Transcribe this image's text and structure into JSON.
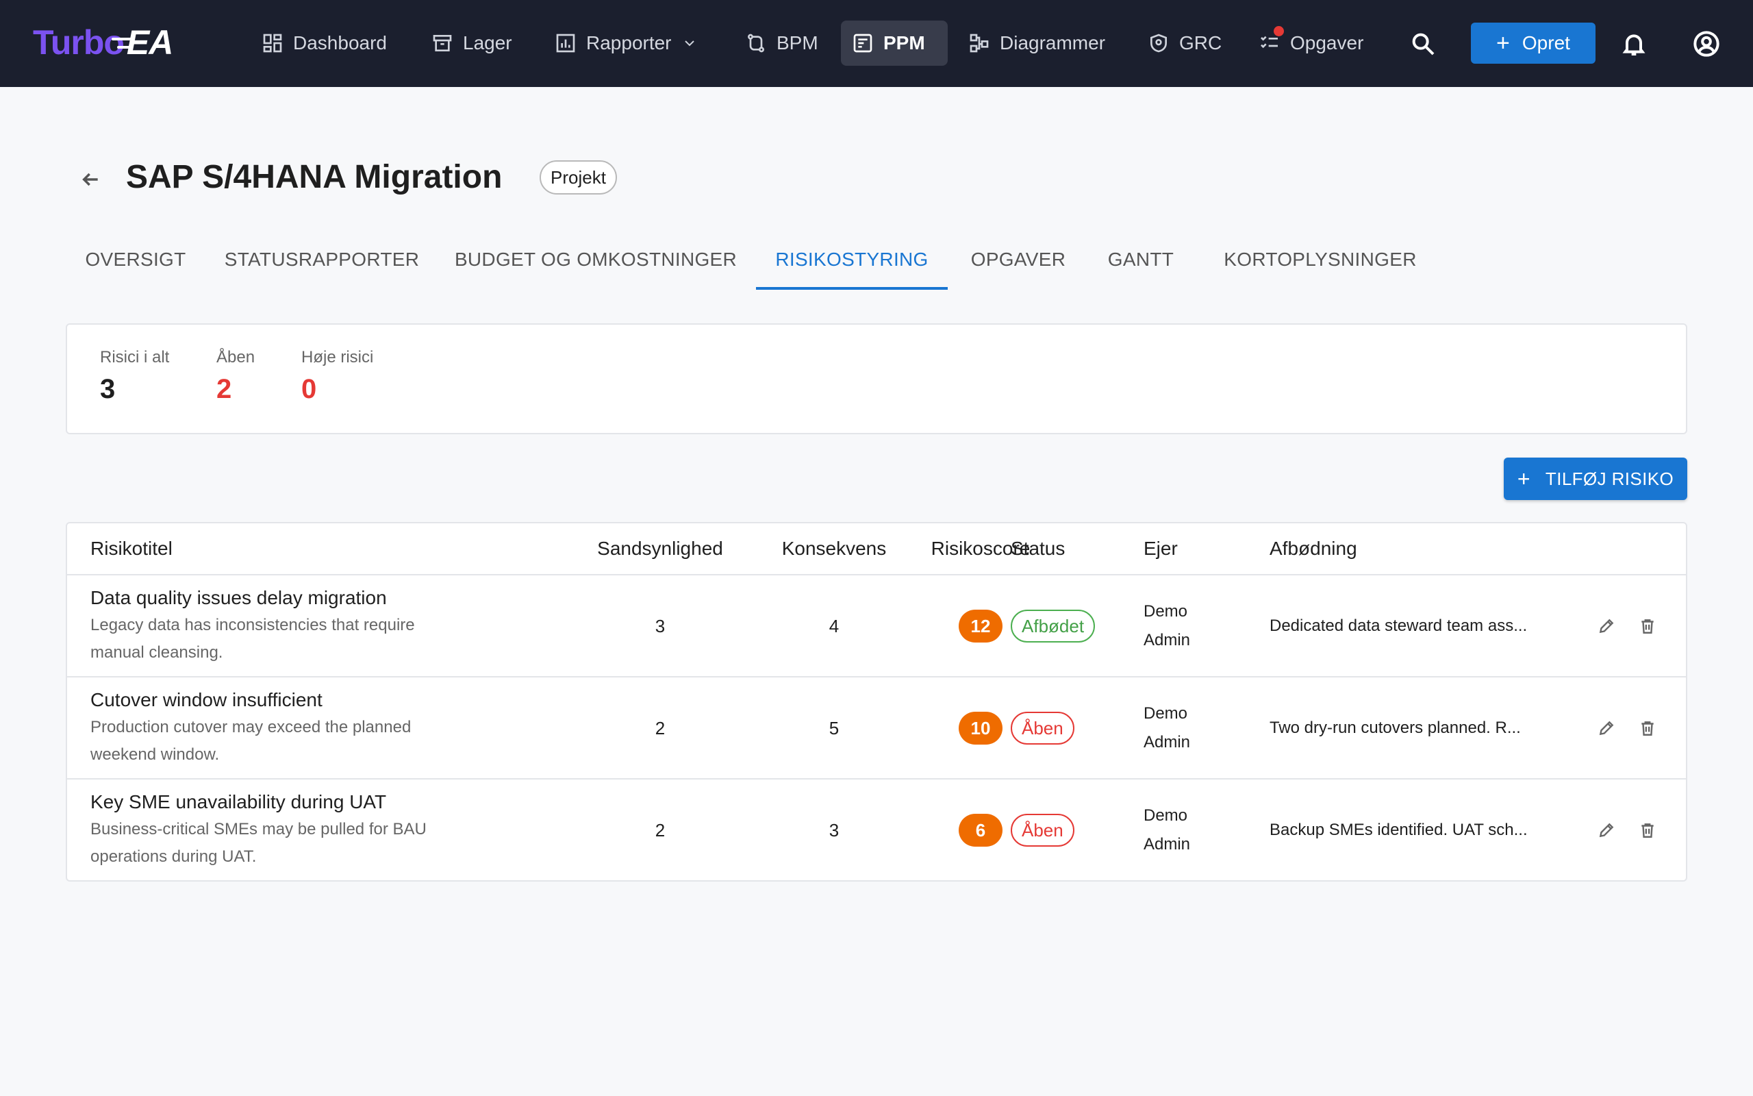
{
  "app": {
    "logo_part1": "Turbo",
    "logo_part2": "EA"
  },
  "nav": {
    "items": [
      {
        "label": "Dashboard",
        "icon": "dashboard-icon"
      },
      {
        "label": "Lager",
        "icon": "archive-icon"
      },
      {
        "label": "Rapporter",
        "icon": "bar-chart-icon"
      },
      {
        "label": "BPM",
        "icon": "process-icon"
      },
      {
        "label": "PPM",
        "icon": "project-icon",
        "active": true
      },
      {
        "label": "Diagrammer",
        "icon": "diagram-icon"
      },
      {
        "label": "GRC",
        "icon": "shield-icon"
      },
      {
        "label": "Opgaver",
        "icon": "checklist-icon"
      }
    ],
    "create_label": "Opret"
  },
  "page": {
    "title": "SAP S/4HANA Migration",
    "type_chip": "Projekt"
  },
  "tabs": [
    {
      "label": "OVERSIGT"
    },
    {
      "label": "STATUSRAPPORTER"
    },
    {
      "label": "BUDGET OG OMKOSTNINGER"
    },
    {
      "label": "RISIKOSTYRING",
      "active": true
    },
    {
      "label": "OPGAVER"
    },
    {
      "label": "GANTT"
    },
    {
      "label": "KORTOPLYSNINGER"
    }
  ],
  "summary": {
    "total_label": "Risici i alt",
    "total_value": "3",
    "open_label": "Åben",
    "open_value": "2",
    "high_label": "Høje risici",
    "high_value": "0"
  },
  "add_risk_label": "TILFØJ RISIKO",
  "table": {
    "columns": [
      "Risikotitel",
      "Sandsynlighed",
      "Konsekvens",
      "Risikoscore",
      "Status",
      "Ejer",
      "Afbødning"
    ],
    "rows": [
      {
        "title": "Data quality issues delay migration",
        "desc_line1": "Legacy data has inconsistencies that require",
        "desc_line2": "manual cleansing.",
        "probability": "3",
        "impact": "4",
        "score": "12",
        "status": "Afbødet",
        "owner_line1": "Demo",
        "owner_line2": "Admin",
        "mitigation": "Dedicated data steward team ass..."
      },
      {
        "title": "Cutover window insufficient",
        "desc_line1": "Production cutover may exceed the planned",
        "desc_line2": "weekend window.",
        "probability": "2",
        "impact": "5",
        "score": "10",
        "status": "Åben",
        "owner_line1": "Demo",
        "owner_line2": "Admin",
        "mitigation": "Two dry-run cutovers planned. R..."
      },
      {
        "title": "Key SME unavailability during UAT",
        "desc_line1": "Business-critical SMEs may be pulled for BAU",
        "desc_line2": "operations during UAT.",
        "probability": "2",
        "impact": "3",
        "score": "6",
        "status": "Åben",
        "owner_line1": "Demo",
        "owner_line2": "Admin",
        "mitigation": "Backup SMEs identified. UAT sch..."
      }
    ]
  },
  "colors": {
    "topbar": "#1b1f2e",
    "primary": "#1976d2",
    "danger": "#e53935",
    "success": "#43a047",
    "score": "#ef6c00"
  }
}
